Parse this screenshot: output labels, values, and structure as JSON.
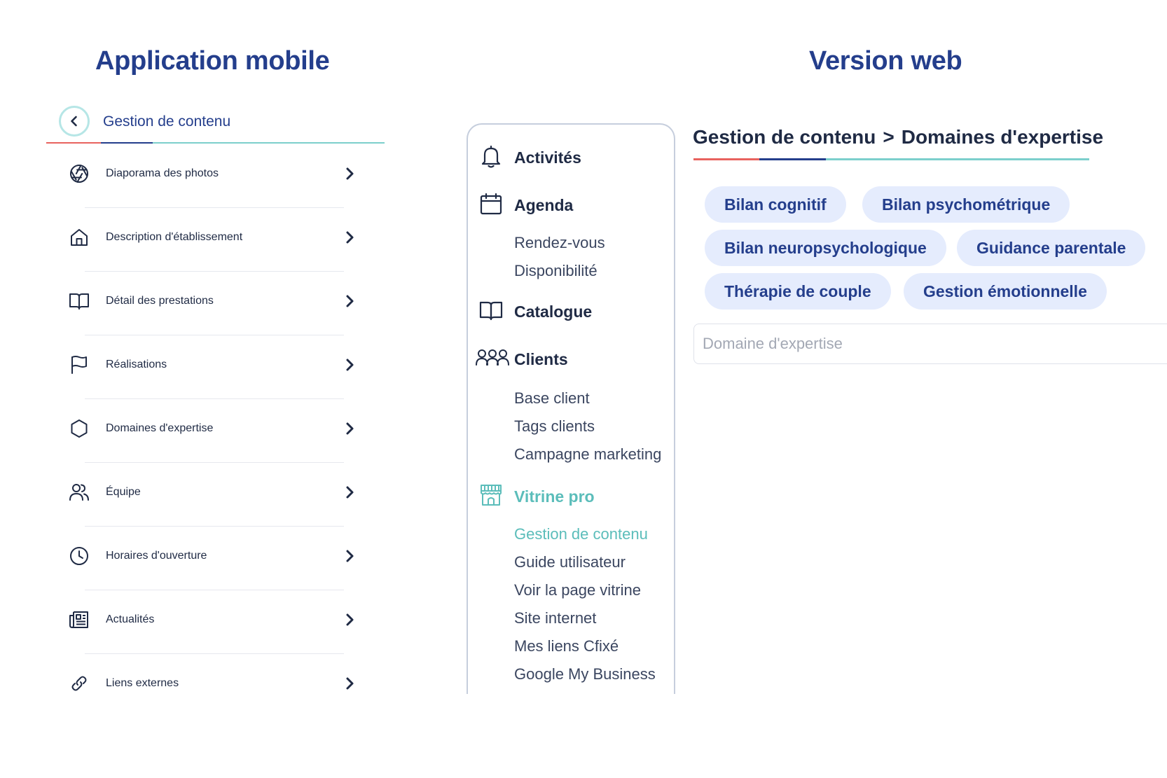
{
  "titles": {
    "mobile": "Application mobile",
    "web": "Version web"
  },
  "mobile": {
    "header_title": "Gestion de contenu",
    "items": [
      {
        "label": "Diaporama des photos",
        "icon": "aperture-icon"
      },
      {
        "label": "Description d'établissement",
        "icon": "home-icon"
      },
      {
        "label": "Détail des prestations",
        "icon": "book-icon"
      },
      {
        "label": "Réalisations",
        "icon": "flag-icon"
      },
      {
        "label": "Domaines d'expertise",
        "icon": "hexagon-icon"
      },
      {
        "label": "Équipe",
        "icon": "users-icon"
      },
      {
        "label": "Horaires d'ouverture",
        "icon": "clock-icon"
      },
      {
        "label": "Actualités",
        "icon": "newspaper-icon"
      },
      {
        "label": "Liens externes",
        "icon": "link-icon"
      }
    ]
  },
  "web": {
    "sidebar": {
      "activites": "Activités",
      "agenda": "Agenda",
      "agenda_items": [
        "Rendez-vous",
        "Disponibilité"
      ],
      "catalogue": "Catalogue",
      "clients": "Clients",
      "clients_items": [
        "Base client",
        "Tags clients",
        "Campagne marketing"
      ],
      "vitrine": "Vitrine pro",
      "vitrine_items": [
        "Gestion de contenu",
        "Guide utilisateur",
        "Voir la page vitrine",
        "Site internet",
        "Mes liens Cfixé",
        "Google My Business"
      ]
    },
    "breadcrumb": {
      "parent": "Gestion de contenu",
      "separator": ">",
      "current": "Domaines d'expertise"
    },
    "tags": [
      "Bilan cognitif",
      "Bilan psychométrique",
      "Bilan neuropsychologique",
      "Guidance parentale",
      "Thérapie de couple",
      "Gestion émotionnelle"
    ],
    "input_placeholder": "Domaine d'expertise"
  },
  "colors": {
    "title_blue": "#243e8c",
    "accent_teal": "#5bbdba",
    "accent_red": "#e8625e",
    "tag_bg": "#e5ecfd"
  }
}
